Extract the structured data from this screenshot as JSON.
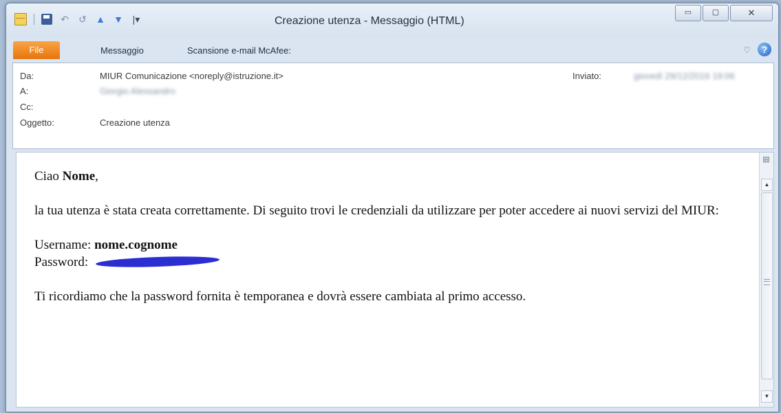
{
  "window": {
    "title": "Creazione utenza - Messaggio (HTML)",
    "buttons": {
      "minimize": "▭",
      "maximize": "▢",
      "close": "✕"
    }
  },
  "qat": {
    "icons": [
      "mail-icon",
      "save-icon",
      "undo-icon",
      "redo-icon",
      "up-icon",
      "down-icon",
      "customize-icon"
    ],
    "redo_glyph": "↺",
    "undo_glyph": "↶",
    "up_glyph": "▲",
    "down_glyph": "▼",
    "more_glyph": "|▾"
  },
  "ribbon": {
    "tabs": [
      {
        "label": "File"
      },
      {
        "label": "Messaggio"
      },
      {
        "label": "Scansione e-mail McAfee:"
      }
    ],
    "help_glyph": "?",
    "heart_glyph": "♡"
  },
  "header": {
    "from": {
      "label": "Da:",
      "value": "MIUR Comunicazione <noreply@istruzione.it>"
    },
    "to": {
      "label": "A:",
      "value": "Giorgio Alessandro"
    },
    "cc": {
      "label": "Cc:",
      "value": ""
    },
    "subject": {
      "label": "Oggetto:",
      "value": "Creazione utenza"
    },
    "sent": {
      "label": "Inviato:",
      "value": "giovedì 29/12/2016 19:06"
    }
  },
  "message": {
    "greeting_prefix": "Ciao ",
    "greeting_name": "Nome",
    "greeting_suffix": ",",
    "line1": "la tua utenza è stata creata correttamente. Di seguito trovi le credenziali da utilizzare per poter accedere ai nuovi servizi del MIUR:",
    "username_label": "Username: ",
    "username_value": "nome.cognome",
    "password_label": "Password: ",
    "footer": "Ti ricordiamo che la password fornita è temporanea e dovrà essere cambiata al primo accesso."
  },
  "colors": {
    "file_tab": "#e8740b",
    "redaction": "#2b2fd1",
    "window_bg": "#dbe5f1"
  }
}
